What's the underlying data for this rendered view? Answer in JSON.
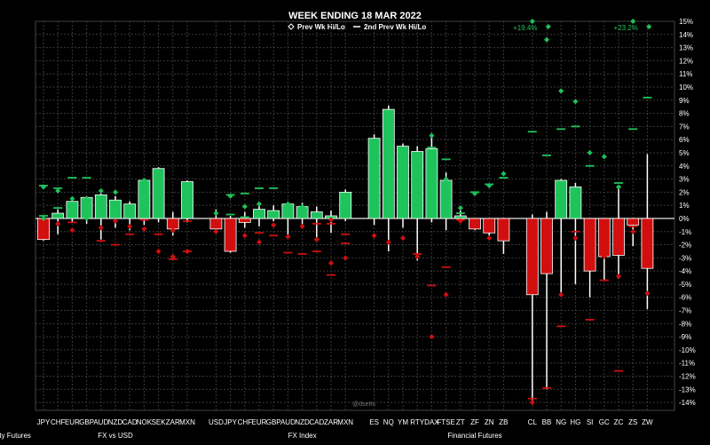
{
  "chart_data": {
    "type": "candlestick",
    "title": "WEEK ENDING 18 MAR 2022",
    "legend": [
      {
        "symbol": "diamond",
        "label": "Prev Wk Hi/Lo"
      },
      {
        "symbol": "dash",
        "label": "2nd Prev Wk Hi/Lo"
      }
    ],
    "y_axis": {
      "side": "right",
      "unit": "%",
      "min": -14,
      "max": 15,
      "step": 1
    },
    "watermark": "@dsethi",
    "colors": {
      "up": "#1fc35c",
      "down": "#d10f0f",
      "prev_up": "#1fc35c",
      "prev_down": "#d10f0f",
      "zero_line": "#ffffff"
    },
    "groups": [
      {
        "label": "FX vs USD",
        "categories": [
          "JPY",
          "CHF",
          "EUR",
          "GBP",
          "AUD",
          "NZD",
          "CAD",
          "NOK",
          "SEK",
          "ZAR",
          "MXN"
        ]
      },
      {
        "label": "FX Index",
        "categories": [
          "USD",
          "JPY",
          "CHF",
          "EUR",
          "GBP",
          "AUD",
          "NZD",
          "CAD",
          "ZAR",
          "MXN"
        ]
      },
      {
        "label": "Financial Futures",
        "categories": [
          "ES",
          "NQ",
          "YM",
          "RTY",
          "DAX",
          "FTSE",
          "ZT",
          "ZF",
          "ZN",
          "ZB"
        ]
      },
      {
        "label": "Commodity Futures",
        "categories": [
          "CL",
          "BB",
          "NG",
          "HG",
          "SI",
          "GC",
          "ZC",
          "ZS",
          "ZW"
        ]
      }
    ],
    "annotations": [
      {
        "category": "CL",
        "text": "+19.4%"
      },
      {
        "category": "ZS",
        "text": "+23.2%"
      }
    ],
    "series": [
      {
        "cat": "JPY",
        "open": 0,
        "close": -1.6,
        "high": 0.1,
        "low": -1.7,
        "prev_hi": 2.4,
        "prev_lo": 0.0,
        "prev2_hi": 2.5,
        "prev2_lo": 0.2
      },
      {
        "cat": "CHF",
        "open": 0,
        "close": 0.4,
        "high": 0.7,
        "low": -1.2,
        "prev_hi": 2.1,
        "prev_lo": -0.4,
        "prev2_hi": 2.3,
        "prev2_lo": 0.8
      },
      {
        "cat": "EUR",
        "open": 0,
        "close": 1.3,
        "high": 1.4,
        "low": -0.3,
        "prev_hi": 1.5,
        "prev_lo": -0.9,
        "prev2_hi": 3.1,
        "prev2_lo": -0.3
      },
      {
        "cat": "GBP",
        "open": 0,
        "close": 1.6,
        "high": 1.7,
        "low": -0.4,
        "prev_hi": 1.5,
        "prev_lo": 0.0,
        "prev2_hi": 3.1,
        "prev2_lo": 1.1
      },
      {
        "cat": "AUD",
        "open": 0,
        "close": 1.8,
        "high": 1.9,
        "low": -1.6,
        "prev_hi": 2.1,
        "prev_lo": -0.7,
        "prev2_hi": 1.7,
        "prev2_lo": -1.7
      },
      {
        "cat": "NZD",
        "open": 0,
        "close": 1.4,
        "high": 1.7,
        "low": -0.7,
        "prev_hi": 2.0,
        "prev_lo": -0.2,
        "prev2_hi": 1.3,
        "prev2_lo": -2.0
      },
      {
        "cat": "CAD",
        "open": 0,
        "close": 1.1,
        "high": 1.3,
        "low": -0.9,
        "prev_hi": 0.6,
        "prev_lo": -0.6,
        "prev2_hi": 0.6,
        "prev2_lo": -1.2
      },
      {
        "cat": "NOK",
        "open": 0,
        "close": 2.9,
        "high": 3.0,
        "low": -0.5,
        "prev_hi": 2.9,
        "prev_lo": -0.8,
        "prev2_hi": 1.8,
        "prev2_lo": -0.1
      },
      {
        "cat": "SEK",
        "open": 0,
        "close": 3.8,
        "high": 3.9,
        "low": -0.3,
        "prev_hi": 3.6,
        "prev_lo": -2.5,
        "prev2_hi": 1.6,
        "prev2_lo": -1.2
      },
      {
        "cat": "ZAR",
        "open": 0,
        "close": -0.8,
        "high": 0.5,
        "low": -1.3,
        "prev_hi": -0.9,
        "prev_lo": -2.9,
        "prev2_hi": -0.6,
        "prev2_lo": -3.1
      },
      {
        "cat": "MXN",
        "open": 0,
        "close": 2.8,
        "high": 2.9,
        "low": -0.3,
        "prev_hi": 0.4,
        "prev_lo": -2.5,
        "prev2_hi": -0.2,
        "prev2_lo": -2.5
      },
      {
        "cat": "USD",
        "open": 0,
        "close": -0.8,
        "high": 0.7,
        "low": -1.0,
        "prev_hi": 0.4,
        "prev_lo": -1.0,
        "prev2_hi": -0.1,
        "prev2_lo": -0.6
      },
      {
        "cat": "JPY",
        "open": 0,
        "close": -2.5,
        "high": 0.2,
        "low": -2.6,
        "prev_hi": 1.7,
        "prev_lo": -0.6,
        "prev2_hi": 1.8,
        "prev2_lo": 0.3
      },
      {
        "cat": "CHF",
        "open": 0,
        "close": -0.3,
        "high": 0.5,
        "low": -0.7,
        "prev_hi": 0.9,
        "prev_lo": -1.3,
        "prev2_hi": 1.9,
        "prev2_lo": 0.1
      },
      {
        "cat": "EUR",
        "open": 0,
        "close": 0.7,
        "high": 1.1,
        "low": -0.6,
        "prev_hi": 1.1,
        "prev_lo": -1.8,
        "prev2_hi": 2.3,
        "prev2_lo": -1.1
      },
      {
        "cat": "GBP",
        "open": 0,
        "close": 0.6,
        "high": 1.0,
        "low": -0.2,
        "prev_hi": 0.4,
        "prev_lo": -0.5,
        "prev2_hi": 2.3,
        "prev2_lo": -1.3
      },
      {
        "cat": "AUD",
        "open": 0,
        "close": 1.1,
        "high": 1.2,
        "low": -1.4,
        "prev_hi": 1.1,
        "prev_lo": -1.4,
        "prev2_hi": 0.5,
        "prev2_lo": -2.6
      },
      {
        "cat": "NZD",
        "open": 0,
        "close": 0.9,
        "high": 1.2,
        "low": -0.6,
        "prev_hi": 0.9,
        "prev_lo": -0.6,
        "prev2_hi": 0.5,
        "prev2_lo": -2.7
      },
      {
        "cat": "CAD",
        "open": 0,
        "close": 0.5,
        "high": 0.9,
        "low": -1.6,
        "prev_hi": 0.2,
        "prev_lo": -1.6,
        "prev2_hi": -0.4,
        "prev2_lo": -2.5
      },
      {
        "cat": "ZAR",
        "open": 0,
        "close": 0.2,
        "high": 0.6,
        "low": -1.1,
        "prev_hi": -0.1,
        "prev_lo": -3.4,
        "prev2_hi": -0.4,
        "prev2_lo": -4.3
      },
      {
        "cat": "MXN",
        "open": 0,
        "close": 2.0,
        "high": 2.2,
        "low": -0.2,
        "prev_hi": 0.2,
        "prev_lo": -3.0,
        "prev2_hi": -1.2,
        "prev2_lo": -1.9
      },
      {
        "cat": "ES",
        "open": 0,
        "close": 6.1,
        "high": 6.4,
        "low": -0.5,
        "prev_hi": 4.6,
        "prev_lo": -1.3,
        "prev2_hi": 5.8,
        "prev2_lo": 1.4
      },
      {
        "cat": "NQ",
        "open": 0,
        "close": 8.3,
        "high": 8.6,
        "low": -2.5,
        "prev_hi": 5.5,
        "prev_lo": -1.8,
        "prev2_hi": 4.3,
        "prev2_lo": 2.2
      },
      {
        "cat": "YM",
        "open": 0,
        "close": 5.5,
        "high": 5.7,
        "low": -0.7,
        "prev_hi": 3.9,
        "prev_lo": -1.5,
        "prev2_hi": 5.3,
        "prev2_lo": 0.8
      },
      {
        "cat": "RTY",
        "open": 0,
        "close": 5.1,
        "high": 5.5,
        "low": -3.2,
        "prev_hi": 3.7,
        "prev_lo": -2.9,
        "prev2_hi": 4.3,
        "prev2_lo": -2.7
      },
      {
        "cat": "DAX",
        "open": 0,
        "close": 5.3,
        "high": 6.5,
        "low": -0.3,
        "prev_hi": 6.3,
        "prev_lo": -9.0,
        "prev2_hi": 5.4,
        "prev2_lo": -5.1
      },
      {
        "cat": "FTSE",
        "open": 0,
        "close": 2.9,
        "high": 3.5,
        "low": -0.9,
        "prev_hi": 3.0,
        "prev_lo": -5.8,
        "prev2_hi": 4.5,
        "prev2_lo": -3.7
      },
      {
        "cat": "ZT",
        "open": 0,
        "close": 0.2,
        "high": 0.6,
        "low": 0.0,
        "prev_hi": 0.8,
        "prev_lo": -0.2,
        "prev2_hi": 0.4,
        "prev2_lo": -0.1
      },
      {
        "cat": "ZF",
        "open": 0,
        "close": -0.8,
        "high": 0.0,
        "low": -0.9,
        "prev_hi": 1.9,
        "prev_lo": -0.6,
        "prev2_hi": 2.0,
        "prev2_lo": -0.6
      },
      {
        "cat": "ZN",
        "open": 0,
        "close": -1.1,
        "high": 0.0,
        "low": -1.3,
        "prev_hi": 2.5,
        "prev_lo": -1.5,
        "prev2_hi": 2.6,
        "prev2_lo": -0.5
      },
      {
        "cat": "ZB",
        "open": 0,
        "close": -1.7,
        "high": 0.0,
        "low": -2.7,
        "prev_hi": 3.4,
        "prev_lo": -1.5,
        "prev2_hi": 3.1,
        "prev2_lo": -0.7
      },
      {
        "cat": "CL",
        "open": 0,
        "close": -5.8,
        "high": 0.3,
        "low": -14.0,
        "prev_hi": 19.4,
        "prev_lo": -14.0,
        "prev2_hi": 6.6,
        "prev2_lo": -13.7
      },
      {
        "cat": "BB",
        "open": 0,
        "close": -4.2,
        "high": 0.5,
        "low": -13.0,
        "prev_hi": 13.6,
        "prev_lo": -2.9,
        "prev2_hi": 4.8,
        "prev2_lo": -12.9
      },
      {
        "cat": "NG",
        "open": 0,
        "close": 2.9,
        "high": 3.0,
        "low": -5.8,
        "prev_hi": 9.7,
        "prev_lo": -5.8,
        "prev2_hi": 6.8,
        "prev2_lo": -8.2
      },
      {
        "cat": "HG",
        "open": 0,
        "close": 2.4,
        "high": 2.7,
        "low": -5.0,
        "prev_hi": 8.9,
        "prev_lo": -1.5,
        "prev2_hi": 7.0,
        "prev2_lo": -1.0
      },
      {
        "cat": "SI",
        "open": 0,
        "close": -4.0,
        "high": -0.8,
        "low": -6.0,
        "prev_hi": 5.0,
        "prev_lo": -2.6,
        "prev2_hi": 4.0,
        "prev2_lo": -7.7
      },
      {
        "cat": "GC",
        "open": 0,
        "close": -2.9,
        "high": -0.9,
        "low": -4.7,
        "prev_hi": 4.7,
        "prev_lo": -2.9,
        "prev2_hi": -0.6,
        "prev2_lo": -4.7
      },
      {
        "cat": "ZC",
        "open": 0,
        "close": -2.8,
        "high": 2.4,
        "low": -4.6,
        "prev_hi": 2.4,
        "prev_lo": -4.4,
        "prev2_hi": 2.7,
        "prev2_lo": -11.6
      },
      {
        "cat": "ZS",
        "open": 0,
        "close": -0.5,
        "high": 0.0,
        "low": -2.1,
        "prev_hi": 23.2,
        "prev_lo": -1.0,
        "prev2_hi": 6.8,
        "prev2_lo": -0.6
      },
      {
        "cat": "ZW",
        "open": 0,
        "close": -3.8,
        "high": 4.9,
        "low": -6.9,
        "prev_hi": -3.0,
        "prev_lo": -5.7,
        "prev2_hi": 9.2,
        "prev2_lo": -3.6
      }
    ]
  }
}
